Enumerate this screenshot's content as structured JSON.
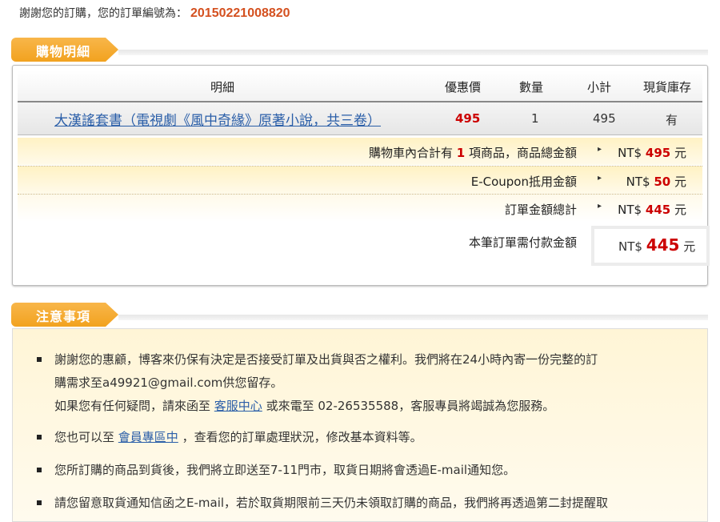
{
  "header": {
    "thanks_text": "謝謝您的訂購，您的訂單編號為：",
    "order_number": "20150221008820"
  },
  "section1": {
    "title": "購物明細",
    "columns": [
      "明細",
      "優惠價",
      "數量",
      "小計",
      "現貨庫存"
    ],
    "items": [
      {
        "name": "大漢謠套書（電視劇《風中奇緣》原著小說，共三卷）",
        "price": "495",
        "qty": "1",
        "subtotal": "495",
        "stock": "有"
      }
    ],
    "summary": {
      "cart_text_a": "購物車內合計有",
      "cart_count": "1",
      "cart_text_b": "項商品，商品總金額",
      "cart_total_prefix": "NT$",
      "cart_total": "495",
      "currency_unit": "元",
      "coupon_label": "E-Coupon抵用金額",
      "coupon_prefix": "NT$",
      "coupon_amount": "50",
      "order_total_label": "訂單金額總計",
      "order_total_prefix": "NT$",
      "order_total": "445",
      "arrow": "▸",
      "pay_label": "本筆訂單需付款金額",
      "pay_prefix": "NT$",
      "pay_amount": "445"
    }
  },
  "section2": {
    "title": "注意事項",
    "notes": {
      "n1_line1": "謝謝您的惠顧，博客來仍保有決定是否接受訂單及出貨與否之權利。我們將在24小時內寄一份完整的訂",
      "n1_line2": "購需求至a49921@gmail.com供您留存。",
      "n1_line3_a": "如果您有任何疑問，請來函至",
      "n1_link": "客服中心",
      "n1_line3_b": "或來電至 02-26535588，客服專員將竭誠為您服務。",
      "n2_a": "您也可以至",
      "n2_link": "會員專區中",
      "n2_b": "，查看您的訂單處理狀況，修改基本資料等。",
      "n3": "您所訂購的商品到貨後，我們將立即送至7-11門市，取貨日期將會透過E-mail通知您。",
      "n4": "請您留意取貨通知信函之E-mail，若於取貨期限前三天仍未領取訂購的商品，我們將再透過第二封提醒取"
    }
  },
  "colors": {
    "accent": "#f2a21f",
    "order_number": "#d4501f",
    "price_red": "#cc0000",
    "link": "#2a5ea8"
  }
}
